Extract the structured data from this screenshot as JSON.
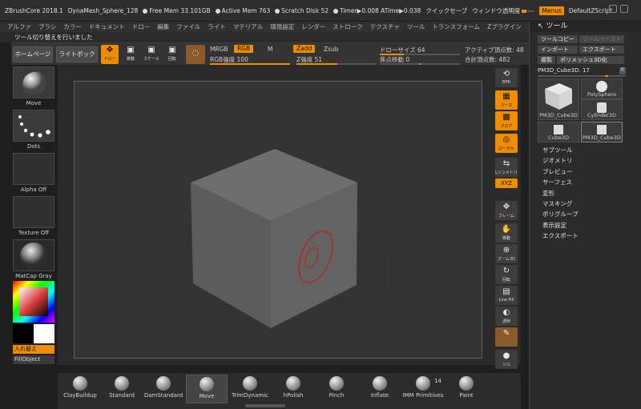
{
  "titlebar": {
    "app": "ZBrushCore 2018.1",
    "document": "DynaMesh_Sphere_128",
    "free_mem": "Free Mem 33.101GB",
    "active_mem": "Active Mem 763",
    "scratch": "Scratch Disk 52",
    "timer": "Timer▶0.008 ATime▶0.038",
    "quicksave": "クイックセーブ",
    "transparency": "ウィンドウ透明度",
    "menus": "Menus",
    "zscript": "DefaultZScript"
  },
  "menubar": [
    "アルファ",
    "ブラシ",
    "カラー",
    "ドキュメント",
    "ドロー",
    "編集",
    "ファイル",
    "ライト",
    "マテリアル",
    "環境設定",
    "レンダー",
    "ストローク",
    "テクスチャ",
    "ツール",
    "トランスフォーム",
    "Zプラグイン"
  ],
  "status": "ツール切り替えを行いました",
  "topshelf": {
    "home": "ホームページ",
    "lightbox": "ライトボックス",
    "draw": "ドロー",
    "move": "移動",
    "scale": "スケール",
    "rotate": "回転",
    "mrgb": "MRGB",
    "rgb": "RGB",
    "m": "M",
    "zadd": "Zadd",
    "zsub": "Zsub",
    "rgb_intensity": "RGB強度 100",
    "z_intensity": "Z強度 51",
    "draw_size": "ドローサイズ 64",
    "focal_shift": "焦点移動 0",
    "active_points": "アクティブ頂点数: 48",
    "total_points": "合計頂点数: 482"
  },
  "leftcol": {
    "brush": "Move",
    "stroke": "Dots",
    "alpha": "Alpha Off",
    "texture": "Texture Off",
    "material": "MatCap Gray",
    "swap": "入れ替え",
    "fill": "FillObject"
  },
  "ricons": [
    {
      "g": "⟲",
      "l": "BPR"
    },
    {
      "g": "▦",
      "l": "パース"
    },
    {
      "g": "▩",
      "l": "フロア"
    },
    {
      "g": "◎",
      "l": "ローカル"
    },
    {
      "g": "⇆",
      "l": "Lシンメトリ"
    },
    {
      "g": "XYZ",
      "l": ""
    },
    {
      "g": "✥",
      "l": "フレーム"
    },
    {
      "g": "✋",
      "l": "移動"
    },
    {
      "g": "⊕",
      "l": "ズーム3D"
    },
    {
      "g": "↻",
      "l": "回転"
    },
    {
      "g": "▤",
      "l": "Line Fill"
    },
    {
      "g": "◐",
      "l": "透明"
    },
    {
      "g": "✎",
      "l": ""
    },
    {
      "g": "●",
      "l": "ソロ"
    }
  ],
  "toolpanel": {
    "title": "ツール",
    "copy": "ツールコピー",
    "paste": "ツールペースト",
    "import": "インポート",
    "export": "エクスポート",
    "clone": "複製",
    "make_polymesh": "ポリメッシュ3D化",
    "current": "PM3D_Cube3D. 17",
    "r": "R",
    "tiles": [
      "PM3D_Cube3D",
      "PolySphere",
      "Cylinder3D",
      "Cube3D",
      "PM3D_Cube3D"
    ],
    "menu": [
      "サブツール",
      "ジオメトリ",
      "プレビュー",
      "サーフェス",
      "変形",
      "マスキング",
      "ポリグループ",
      "表示設定",
      "エクスポート"
    ]
  },
  "brushes": [
    {
      "name": "ClayBuildup"
    },
    {
      "name": "Standard"
    },
    {
      "name": "DamStandard"
    },
    {
      "name": "Move"
    },
    {
      "name": "TrimDynamic"
    },
    {
      "name": "hPolish"
    },
    {
      "name": "Pinch"
    },
    {
      "name": "Inflate"
    },
    {
      "name": "IMM Primitives"
    },
    {
      "name": "Paint"
    }
  ],
  "imm_count": "14",
  "colors": {
    "accent": "#f08c00",
    "bg": "#333333"
  }
}
